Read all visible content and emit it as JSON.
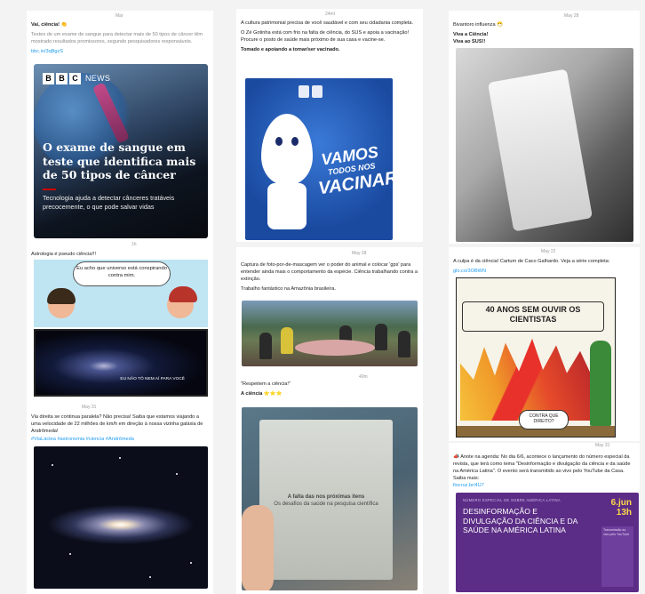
{
  "cards": {
    "c1": {
      "date": "Mar",
      "handle_text": "Vai, ciência! 👏",
      "body": "Testes de um exame de sangue para detectar mais de 50 tipos de câncer têm mostrado resultados promissores, segundo pesquisadores responsáveis.",
      "link": "bbc.in/3qBgzS",
      "image": {
        "brand": "NEWS",
        "headline": "O exame de sangue em teste que identifica mais de 50 tipos de câncer",
        "subtitle": "Tecnologia ajuda a detectar cânceres tratáveis precocemente, o que pode salvar vidas"
      }
    },
    "c2": {
      "date": "24ml",
      "body1": "A cultura patrimonial precisa de você saudável e com seu cidadania completa.",
      "body2": "O Zé Gotinha está com frio na falta de ciência, do SUS e apoia a vacinação! Procure o posto de saúde mais próximo de sua casa e vacine-se.",
      "body3": "Tomado e apoiando a tomar/ser vacinado.",
      "image": {
        "line1": "VAMOS",
        "line2": "TODOS NOS",
        "line3": "VACINAR!"
      }
    },
    "c3": {
      "date": "May 28",
      "line1": "Bivantoro influenza 😷",
      "line2": "Viva a Ciência!",
      "line3": "Viva ao SUS!!"
    },
    "c4": {
      "date": "1h",
      "body": "Astrologia é pseudo ciência!!!",
      "bubble": "Eu acho que universo está conspirando contra mim.",
      "caption": "EU NÃO TÔ NEM AÍ PARA VOCÊ"
    },
    "c5": {
      "date": "May 28",
      "body1": "Captura de foto-por-de-mascagem ver o poder do animal e colocar 'gps' para entender ainda mais o comportamento da espécie. Ciência trabalhando contra a extinção.",
      "body2": "Trabalho fantástico na Amazônia brasileira."
    },
    "c6": {
      "date": "May 22",
      "body": "A culpa é da ciência! Cartum de Caco Galhardo. Veja a série completa:",
      "link": "glo.co/3OBWN",
      "sign": "40 ANOS SEM OUVIR OS CIENTISTAS",
      "speech": "CONTRA QUE DIREITO?"
    },
    "c7": {
      "date": "May 31",
      "body": "Via direita se continua paralela? Não precisa! Saiba que estamos viajando a uma velocidade de 22 milhões de km/h em direção à nossa vizinha galáxia de Andrômeda!",
      "tags": "#ViaLáctea #astronomia #ciencia #Andrômeda"
    },
    "c8": {
      "date": "40m",
      "body1": "\"Respeitem a ciência!\"",
      "body2": "A ciência ⭐⭐⭐",
      "book_title": "A falta das nos próximas itens",
      "book_sub": "Os desafios da saúde na pesquisa científica"
    },
    "c9": {
      "date": "May 31",
      "body": "📣 Anote na agenda: No dia 6/6, acontece o lançamento do número especial da revista, que terá como tema \"Desinformação e divulgação da ciência e da saúde na América Latina\". O evento será transmitido ao vivo pelo YouTube da Casa. Saiba mais:",
      "link": "fiocruz.br/4U7",
      "event": {
        "header": "NÚMERO ESPECIAL DE SOBRE AMÉRICA LATINA",
        "title": "DESINFORMAÇÃO E DIVULGAÇÃO DA CIÊNCIA E DA SAÚDE NA AMÉRICA LATINA",
        "day": "6.jun",
        "time": "13h",
        "panel": "Transmissão ao vivo pelo YouTube"
      }
    }
  },
  "colors": {
    "link": "#1d9bf0",
    "event_bg": "#5b2d86",
    "vacinar_bg": "#1a4aa0"
  }
}
